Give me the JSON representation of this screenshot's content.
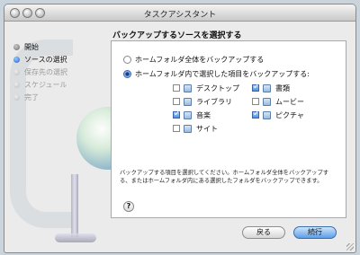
{
  "window": {
    "title": "タスクアシスタント"
  },
  "sidebar": {
    "steps": [
      {
        "label": "開始",
        "state": "done"
      },
      {
        "label": "ソースの選択",
        "state": "current"
      },
      {
        "label": "保存先の選択",
        "state": "pending"
      },
      {
        "label": "スケジュール",
        "state": "pending"
      },
      {
        "label": "完了",
        "state": "pending"
      }
    ]
  },
  "main": {
    "heading": "バックアップするソースを選択する",
    "option_all": {
      "label": "ホームフォルダ全体をバックアップする",
      "selected": false
    },
    "option_selected": {
      "label": "ホームフォルダ内で選択した項目をバックアップする:",
      "selected": true
    },
    "items": [
      {
        "label": "デスクトップ",
        "checked": false
      },
      {
        "label": "書類",
        "checked": true
      },
      {
        "label": "ライブラリ",
        "checked": false
      },
      {
        "label": "ムービー",
        "checked": false
      },
      {
        "label": "音楽",
        "checked": true
      },
      {
        "label": "ピクチャ",
        "checked": true
      },
      {
        "label": "サイト",
        "checked": false
      }
    ],
    "description_line1": "バックアップする項目を選択してください。ホームフォルダ全体をバックアップす",
    "description_line2": "る、またはホームフォルダ内にある選択したフォルダをバックアップできます。",
    "help_label": "?"
  },
  "buttons": {
    "back": "戻る",
    "next": "続行"
  }
}
